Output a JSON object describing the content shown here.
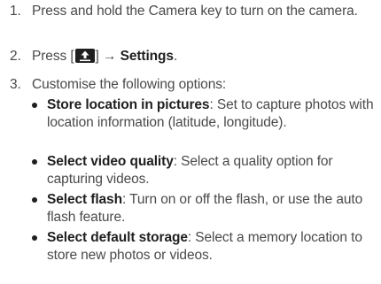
{
  "steps": [
    {
      "number": "1.",
      "text": "Press and hold the Camera key to turn on the camera."
    },
    {
      "number": "2.",
      "prefix": "Press [",
      "icon": "upload-menu-icon",
      "middle": "] → ",
      "bold": "Settings",
      "suffix": "."
    },
    {
      "number": "3.",
      "text": "Customise the following options:"
    }
  ],
  "options": [
    {
      "title": "Store location in pictures",
      "desc": ": Set to capture photos with location information (latitude, longitude)."
    },
    {
      "title": "Select video quality",
      "desc": ": Select a quality option for capturing videos."
    },
    {
      "title": "Select flash",
      "desc": ": Turn on or off the flash, or use the auto flash feature."
    },
    {
      "title": "Select default storage",
      "desc": ": Select a memory location to store new photos or videos."
    }
  ]
}
